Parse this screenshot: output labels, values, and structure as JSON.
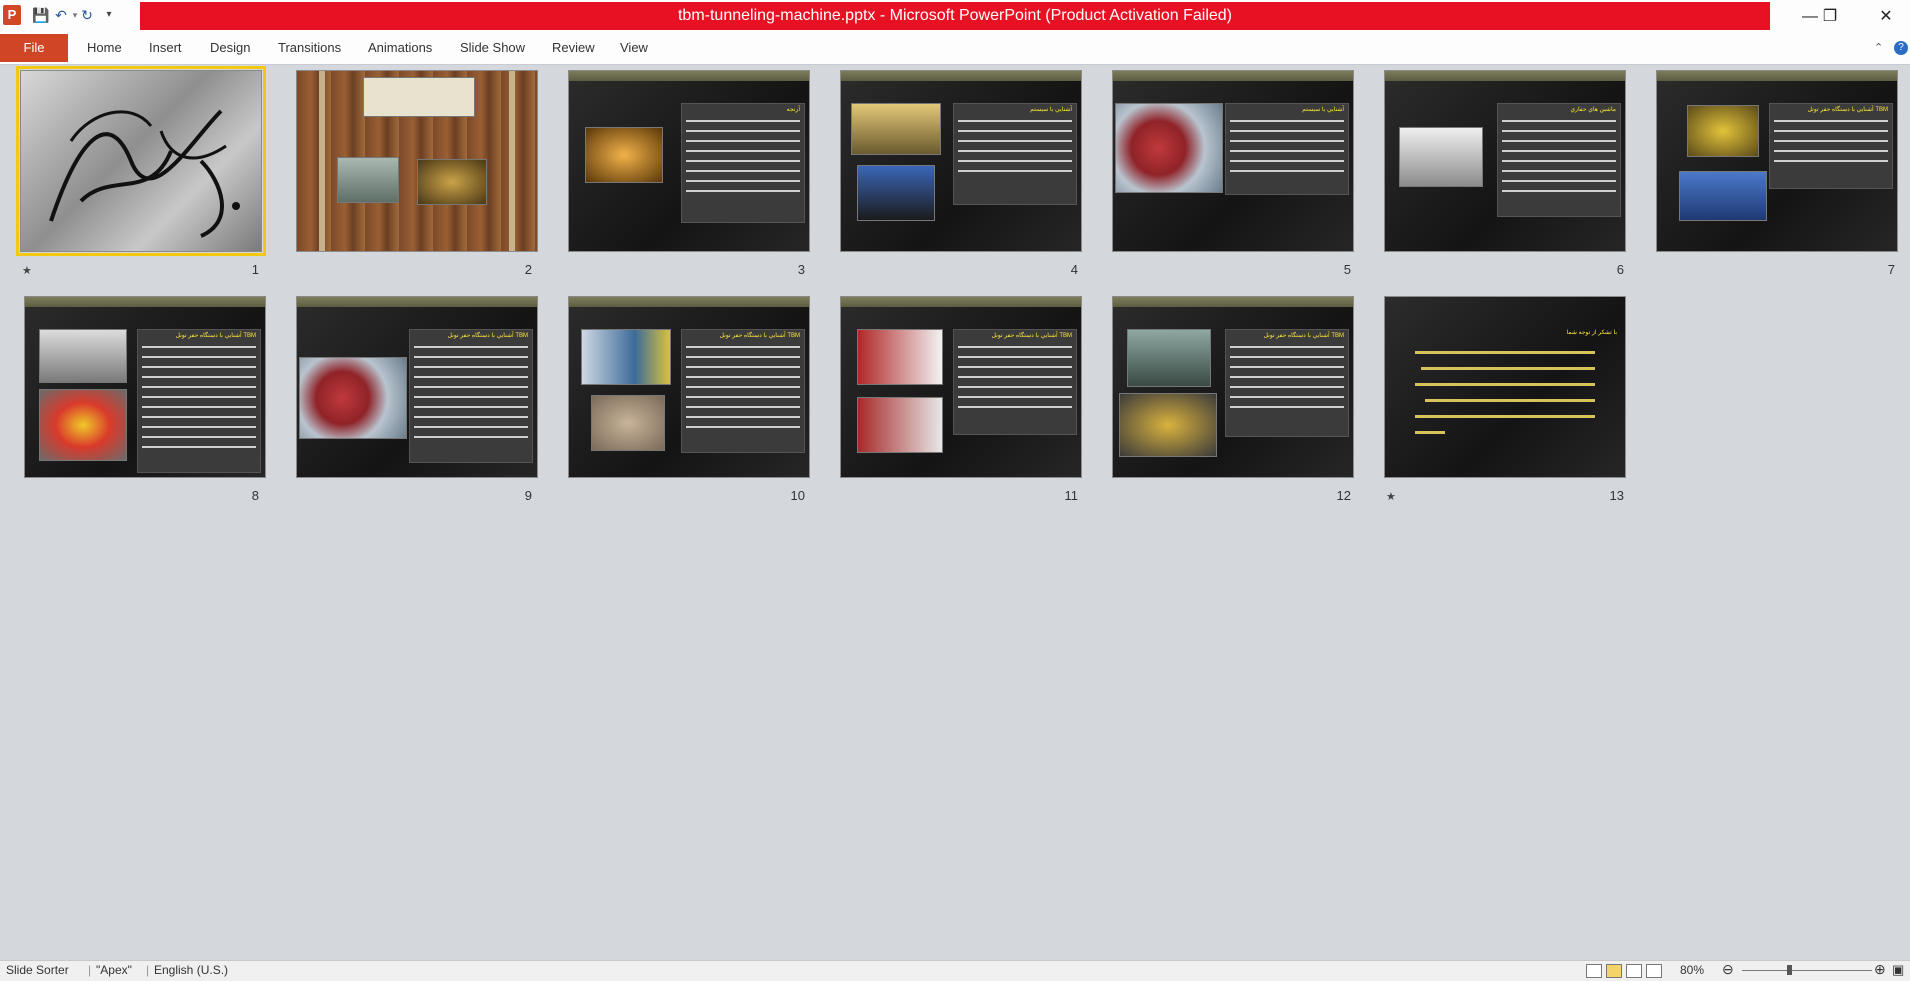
{
  "window": {
    "title": "tbm-tunneling-machine.pptx -  Microsoft PowerPoint (Product Activation Failed)",
    "app_icon": "P",
    "title_color": "#e81123"
  },
  "ribbon": {
    "file_label": "File",
    "tabs": [
      "Home",
      "Insert",
      "Design",
      "Transitions",
      "Animations",
      "Slide Show",
      "Review",
      "View"
    ]
  },
  "slides": [
    {
      "number": "1",
      "title": "",
      "selected": true
    },
    {
      "number": "2",
      "title": ""
    },
    {
      "number": "3",
      "title": "آرنجه"
    },
    {
      "number": "4",
      "title": "آشنايي با سيستم"
    },
    {
      "number": "5",
      "title": "آشنايي با سيستم"
    },
    {
      "number": "6",
      "title": "ماشين هاي حفاري"
    },
    {
      "number": "7",
      "title": "آشنايي با دستگاه حفر تونل TBM"
    },
    {
      "number": "8",
      "title": "آشنايي با دستگاه حفر تونل TBM"
    },
    {
      "number": "9",
      "title": "آشنايي با دستگاه حفر تونل TBM"
    },
    {
      "number": "10",
      "title": "آشنايي با دستگاه حفر تونل TBM"
    },
    {
      "number": "11",
      "title": "آشنايي با دستگاه حفر تونل TBM"
    },
    {
      "number": "12",
      "title": "آشنايي با دستگاه حفر تونل TBM"
    },
    {
      "number": "13",
      "title": "با تشكر از توجه شما"
    }
  ],
  "statusbar": {
    "view": "Slide Sorter",
    "theme": "\"Apex\"",
    "language": "English (U.S.)",
    "zoom": "80%"
  }
}
